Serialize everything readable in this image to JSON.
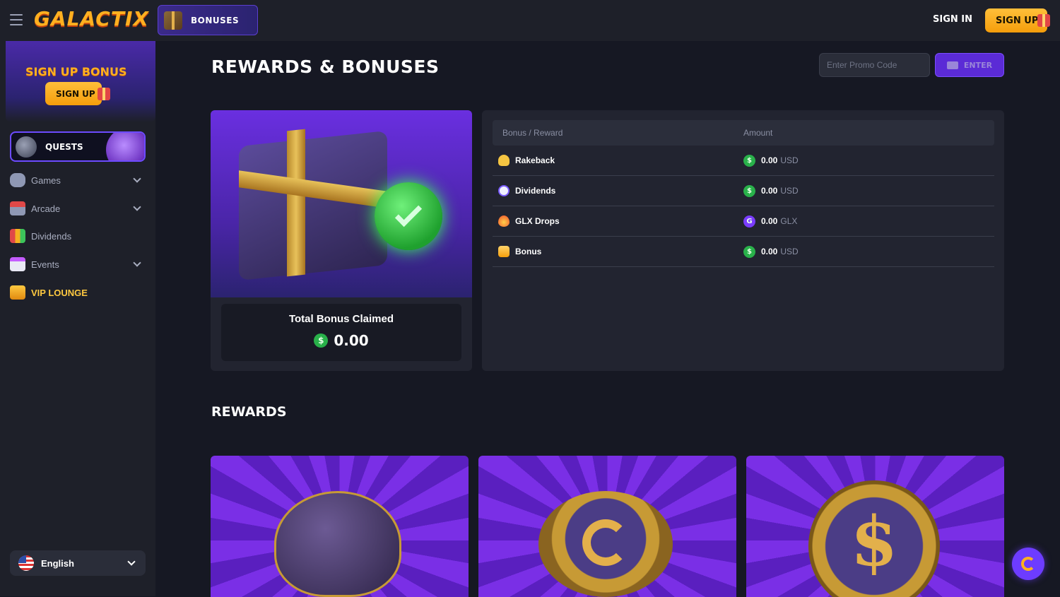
{
  "header": {
    "logo": "GALACTIX",
    "active_tab": "BONUSES",
    "sign_in": "SIGN IN",
    "sign_up": "SIGN UP"
  },
  "sidebar": {
    "promo_title": "SIGN UP BONUS",
    "promo_button": "SIGN UP",
    "quests_label": "QUESTS",
    "items": [
      {
        "label": "Games",
        "icon": "gamepad-icon",
        "expandable": true
      },
      {
        "label": "Arcade",
        "icon": "joystick-icon",
        "expandable": true
      },
      {
        "label": "Dividends",
        "icon": "bar-chart-icon",
        "expandable": false
      },
      {
        "label": "Events",
        "icon": "calendar-icon",
        "expandable": true
      },
      {
        "label": "VIP LOUNGE",
        "icon": "crown-icon",
        "expandable": false
      }
    ],
    "language": "English"
  },
  "main": {
    "title": "REWARDS & BONUSES",
    "promo_placeholder": "Enter Promo Code",
    "enter_button": "ENTER",
    "total_label": "Total Bonus Claimed",
    "total_value": "0.00",
    "table": {
      "headers": [
        "Bonus / Reward",
        "Amount"
      ],
      "rows": [
        {
          "name": "Rakeback",
          "amount": "0.00",
          "unit": "USD",
          "icon": "hand-coin-icon",
          "currency_icon": "usd-coin-icon"
        },
        {
          "name": "Dividends",
          "amount": "0.00",
          "unit": "USD",
          "icon": "percent-icon",
          "currency_icon": "usd-coin-icon"
        },
        {
          "name": "GLX Drops",
          "amount": "0.00",
          "unit": "GLX",
          "icon": "drop-icon",
          "currency_icon": "glx-coin-icon"
        },
        {
          "name": "Bonus",
          "amount": "0.00",
          "unit": "USD",
          "icon": "gift-icon",
          "currency_icon": "usd-coin-icon"
        }
      ]
    },
    "rewards_title": "REWARDS"
  },
  "colors": {
    "accent_purple": "#6d3cff",
    "gold": "#ffb020",
    "usd_green": "#29b14a",
    "background": "#161823"
  }
}
